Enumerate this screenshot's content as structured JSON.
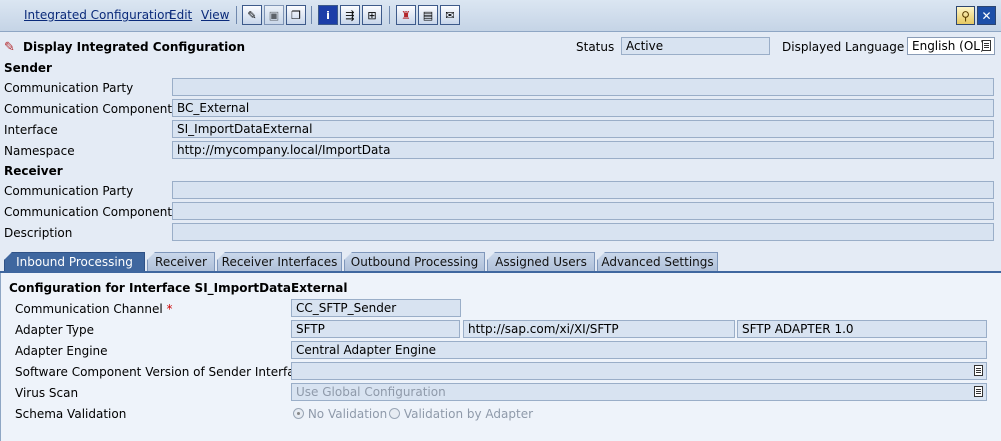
{
  "menu": {
    "integrated_configuration": "Integrated Configuration",
    "edit": "Edit",
    "view": "View"
  },
  "header": {
    "title": "Display Integrated Configuration",
    "status_label": "Status",
    "status_value": "Active",
    "language_label": "Displayed Language",
    "language_value": "English (OL)"
  },
  "sender": {
    "heading": "Sender",
    "party_label": "Communication Party",
    "party_value": "",
    "component_label": "Communication Component",
    "component_value": "BC_External",
    "interface_label": "Interface",
    "interface_value": "SI_ImportDataExternal",
    "namespace_label": "Namespace",
    "namespace_value": "http://mycompany.local/ImportData"
  },
  "receiver": {
    "heading": "Receiver",
    "party_label": "Communication Party",
    "party_value": "",
    "component_label": "Communication Component",
    "component_value": "",
    "description_label": "Description",
    "description_value": ""
  },
  "tabs": [
    {
      "label": "Inbound Processing"
    },
    {
      "label": "Receiver"
    },
    {
      "label": "Receiver Interfaces"
    },
    {
      "label": "Outbound Processing"
    },
    {
      "label": "Assigned Users"
    },
    {
      "label": "Advanced Settings"
    }
  ],
  "inbound": {
    "heading": "Configuration for Interface SI_ImportDataExternal",
    "channel_label": "Communication Channel",
    "required_mark": "*",
    "channel_value": "CC_SFTP_Sender",
    "adapter_type_label": "Adapter Type",
    "adapter_type_value": "SFTP",
    "adapter_namespace": "http://sap.com/xi/XI/SFTP",
    "adapter_version": "SFTP ADAPTER 1.0",
    "engine_label": "Adapter Engine",
    "engine_value": "Central Adapter Engine",
    "swcv_label": "Software Component Version of Sender Interface",
    "swcv_value": "",
    "virus_label": "Virus Scan",
    "virus_value": "Use Global Configuration",
    "schema_label": "Schema Validation",
    "schema_options": [
      "No Validation",
      "Validation by Adapter"
    ],
    "schema_selected": "No Validation"
  },
  "colors": {
    "active_tab": "#3f679f",
    "field_bg": "#d8e3f1",
    "window_bg": "#e4ebf5"
  }
}
